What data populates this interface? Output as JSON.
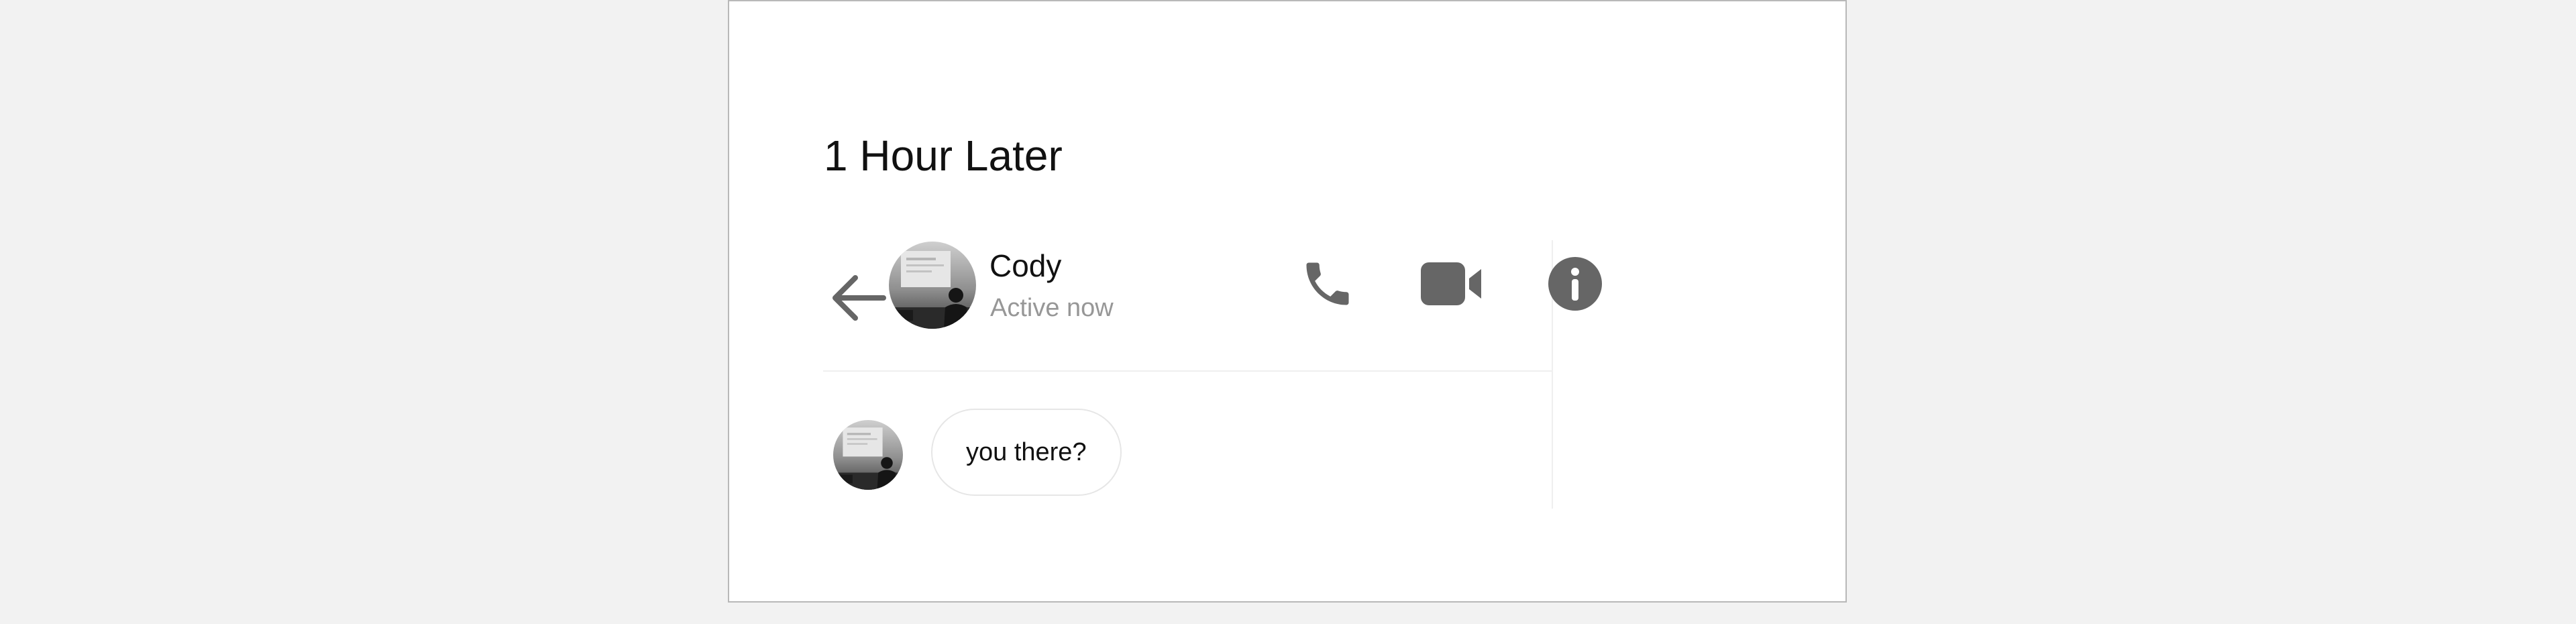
{
  "scene": {
    "title": "1 Hour Later"
  },
  "chat": {
    "contact": {
      "name": "Cody",
      "status": "Active now",
      "avatar": "profile-photo"
    },
    "header_actions": [
      {
        "icon": "back-arrow-icon"
      },
      {
        "icon": "phone-icon"
      },
      {
        "icon": "video-camera-icon"
      },
      {
        "icon": "info-icon"
      }
    ],
    "messages": [
      {
        "from": "Cody",
        "text": "you there?"
      }
    ]
  },
  "colors": {
    "page_background": "#f2f2f2",
    "card_background": "#ffffff",
    "icon_gray": "#666666",
    "status_gray": "#979797",
    "divider": "#efefef"
  }
}
